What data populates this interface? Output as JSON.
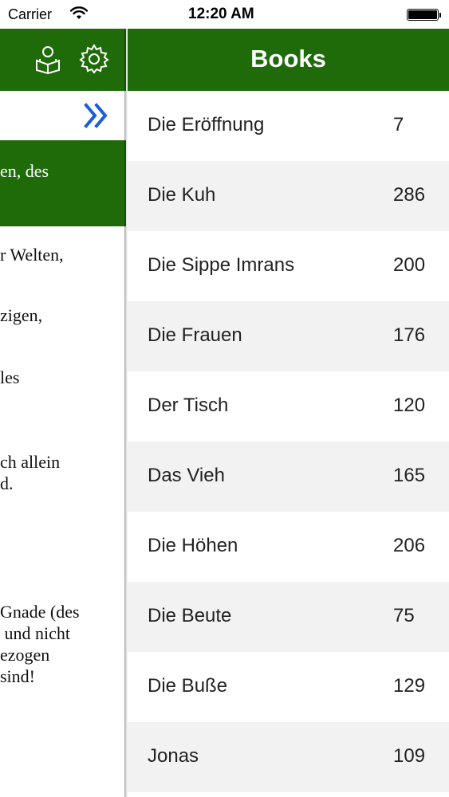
{
  "status_bar": {
    "carrier": "Carrier",
    "time": "12:20 AM"
  },
  "reader": {
    "highlight_line": "en, des",
    "verses": [
      "r Welten,",
      "zigen,",
      "les",
      "ch allein\nd.",
      "Gnade (des\n und nicht\nezogen\nsind!"
    ],
    "icons": [
      "reader-icon",
      "gear-icon",
      "chevron-double-right-icon"
    ],
    "accent": "#1f6b0a"
  },
  "books": {
    "title": "Books",
    "items": [
      {
        "name": "Die Eröffnung",
        "count": "7"
      },
      {
        "name": "Die Kuh",
        "count": "286"
      },
      {
        "name": "Die Sippe Imrans",
        "count": "200"
      },
      {
        "name": "Die Frauen",
        "count": "176"
      },
      {
        "name": "Der Tisch",
        "count": "120"
      },
      {
        "name": "Das Vieh",
        "count": "165"
      },
      {
        "name": "Die Höhen",
        "count": "206"
      },
      {
        "name": "Die Beute",
        "count": "75"
      },
      {
        "name": "Die Buße",
        "count": "129"
      },
      {
        "name": "Jonas",
        "count": "109"
      }
    ]
  }
}
